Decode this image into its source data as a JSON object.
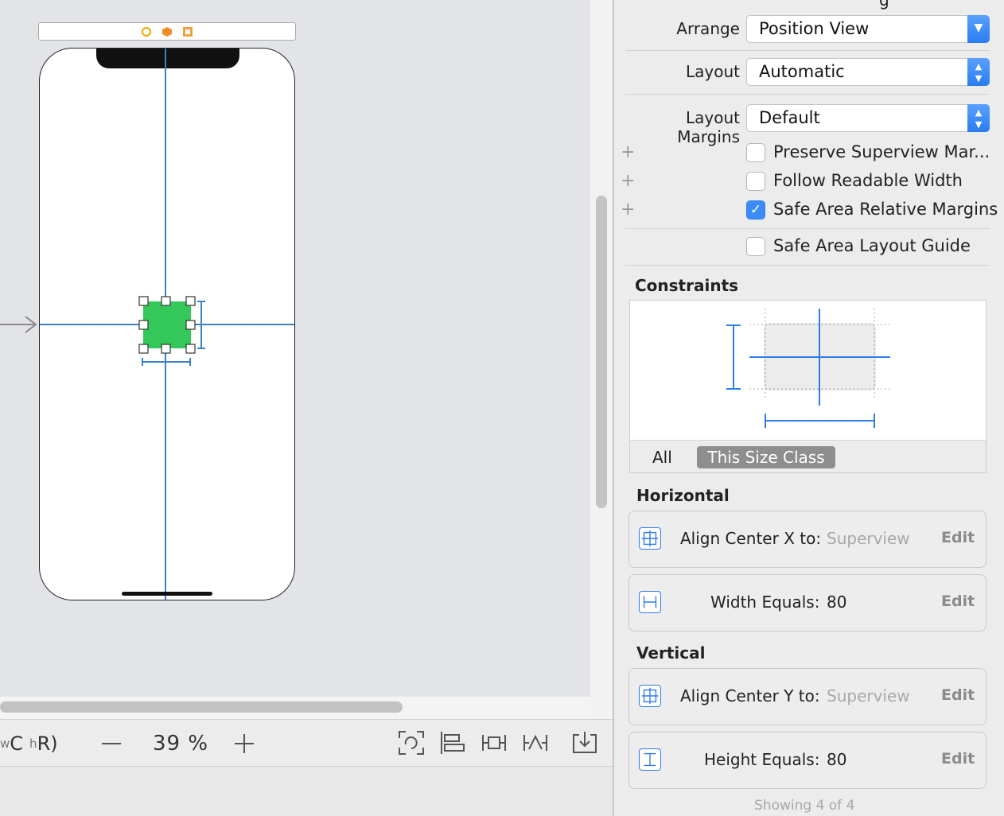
{
  "canvas": {
    "device_config": {
      "w": "w",
      "c": "C",
      "h": "h",
      "r": "R)"
    },
    "zoom_out_icon": "minus-icon",
    "zoom_level": "39 %",
    "zoom_in_icon": "plus-icon",
    "tools": [
      "refresh-layout-icon",
      "align-icon",
      "add-constraints-icon",
      "resolve-issues-icon",
      "embed-in-icon"
    ]
  },
  "inspector": {
    "top_cut_text": "g",
    "arrange": {
      "label": "Arrange",
      "value": "Position View"
    },
    "layout": {
      "label": "Layout",
      "value": "Automatic"
    },
    "layout_margins": {
      "label": "Layout Margins",
      "value": "Default"
    },
    "checkboxes": [
      {
        "label": "Preserve Superview Mar...",
        "checked": false
      },
      {
        "label": "Follow Readable Width",
        "checked": false
      },
      {
        "label": "Safe Area Relative Margins",
        "checked": true
      },
      {
        "label": "Safe Area Layout Guide",
        "checked": false
      }
    ],
    "constraints_title": "Constraints",
    "tabs": {
      "all": "All",
      "size_class": "This Size Class"
    },
    "horizontal_title": "Horizontal",
    "vertical_title": "Vertical",
    "constraints": [
      {
        "label": "Align Center X to:",
        "value": "Superview",
        "edit": "Edit",
        "icon": "center-x-icon"
      },
      {
        "label": "Width Equals:",
        "value": "80",
        "edit": "Edit",
        "icon": "width-icon"
      },
      {
        "label": "Align Center Y to:",
        "value": "Superview",
        "edit": "Edit",
        "icon": "center-y-icon"
      },
      {
        "label": "Height Equals:",
        "value": "80",
        "edit": "Edit",
        "icon": "height-icon"
      }
    ],
    "showing": "Showing 4 of 4"
  },
  "colors": {
    "accent": "#2f7de8",
    "view_fill": "#34c759",
    "guide": "#3a82c4"
  }
}
